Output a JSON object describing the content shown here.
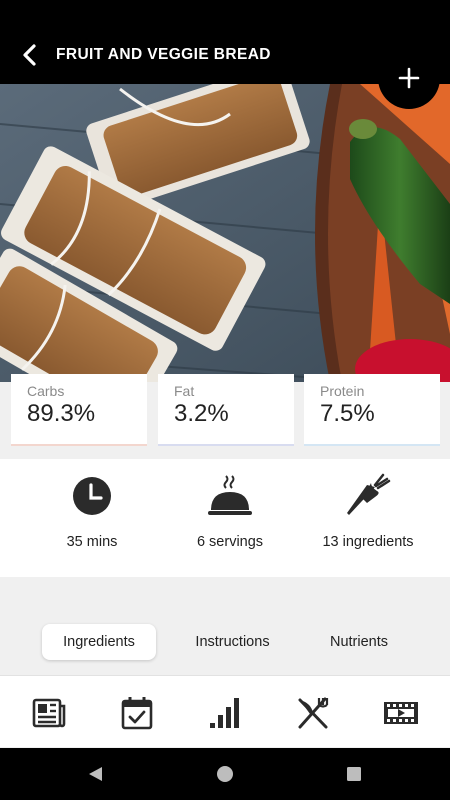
{
  "header": {
    "title": "FRUIT AND VEGGIE BREAD",
    "back_icon": "chevron-left-icon",
    "add_icon": "plus-icon"
  },
  "macros": [
    {
      "label": "Carbs",
      "value": "89.3%",
      "accent": "#f3d6ce"
    },
    {
      "label": "Fat",
      "value": "3.2%",
      "accent": "#d8dcf0"
    },
    {
      "label": "Protein",
      "value": "7.5%",
      "accent": "#d4e6f4"
    }
  ],
  "info": [
    {
      "icon": "clock-icon",
      "text": "35 mins"
    },
    {
      "icon": "serving-cloche-icon",
      "text": "6 servings"
    },
    {
      "icon": "carrot-icon",
      "text": "13 ingredients"
    }
  ],
  "tabs": [
    {
      "label": "Ingredients",
      "active": true
    },
    {
      "label": "Instructions",
      "active": false
    },
    {
      "label": "Nutrients",
      "active": false
    }
  ],
  "bottom_nav": [
    "newspaper-icon",
    "calendar-check-icon",
    "bar-chart-icon",
    "fork-knife-icon",
    "video-film-icon"
  ],
  "system_nav": [
    "back-triangle-icon",
    "home-circle-icon",
    "recents-square-icon"
  ],
  "colors": {
    "app_bar": "#000000",
    "background": "#f0f0f0",
    "card": "#ffffff",
    "icon": "#2b2b2b"
  }
}
